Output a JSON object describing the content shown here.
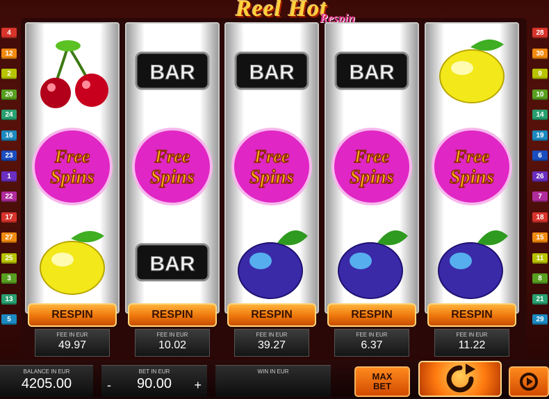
{
  "logo": {
    "title": "Reel Hot",
    "subtitle": "Respin"
  },
  "line_numbers": {
    "left": [
      "4",
      "12",
      "2",
      "20",
      "24",
      "16",
      "23",
      "1",
      "22",
      "17",
      "27",
      "25",
      "3",
      "13",
      "5"
    ],
    "right": [
      "28",
      "30",
      "9",
      "10",
      "14",
      "19",
      "6",
      "26",
      "7",
      "18",
      "15",
      "11",
      "8",
      "21",
      "29"
    ]
  },
  "line_colors": {
    "left": [
      "#d8342c",
      "#f08a10",
      "#b8c400",
      "#58a020",
      "#28a070",
      "#1c8ac0",
      "#1a4ec0",
      "#6a2ec0",
      "#b02c9c",
      "#d8342c",
      "#f08a10",
      "#b8c400",
      "#58a020",
      "#28a070",
      "#1c8ac0"
    ],
    "right": [
      "#d8342c",
      "#f08a10",
      "#b8c400",
      "#58a020",
      "#28a070",
      "#1c8ac0",
      "#1a4ec0",
      "#6a2ec0",
      "#b02c9c",
      "#d8342c",
      "#f08a10",
      "#b8c400",
      "#58a020",
      "#28a070",
      "#1c8ac0"
    ]
  },
  "reels": [
    {
      "symbols": [
        "cherry-icon",
        "free-spins-icon",
        "lemon-icon"
      ],
      "respin_label": "RESPIN",
      "fee_label": "FEE IN EUR",
      "fee": "49.97"
    },
    {
      "symbols": [
        "bar-icon",
        "free-spins-icon",
        "bar-icon"
      ],
      "respin_label": "RESPIN",
      "fee_label": "FEE IN EUR",
      "fee": "10.02"
    },
    {
      "symbols": [
        "bar-icon",
        "free-spins-icon",
        "plum-icon"
      ],
      "respin_label": "RESPIN",
      "fee_label": "FEE IN EUR",
      "fee": "39.27"
    },
    {
      "symbols": [
        "bar-icon",
        "free-spins-icon",
        "plum-icon"
      ],
      "respin_label": "RESPIN",
      "fee_label": "FEE IN EUR",
      "fee": "6.37"
    },
    {
      "symbols": [
        "lemon-icon",
        "free-spins-icon",
        "plum-icon"
      ],
      "respin_label": "RESPIN",
      "fee_label": "FEE IN EUR",
      "fee": "11.22"
    }
  ],
  "symbol_text": {
    "bar": "BAR",
    "free_line1": "Free",
    "free_line2": "Spins"
  },
  "bottom": {
    "balance_label": "BALANCE IN EUR",
    "balance": "4205.00",
    "bet_label": "BET IN EUR",
    "bet": "90.00",
    "minus": "-",
    "plus": "+",
    "win_label": "WIN IN EUR",
    "win": "",
    "maxbet_line1": "MAX",
    "maxbet_line2": "BET"
  },
  "colors": {
    "accent": "#f07b0e",
    "frame": "#5a120b",
    "gold": "#ffd23c"
  }
}
